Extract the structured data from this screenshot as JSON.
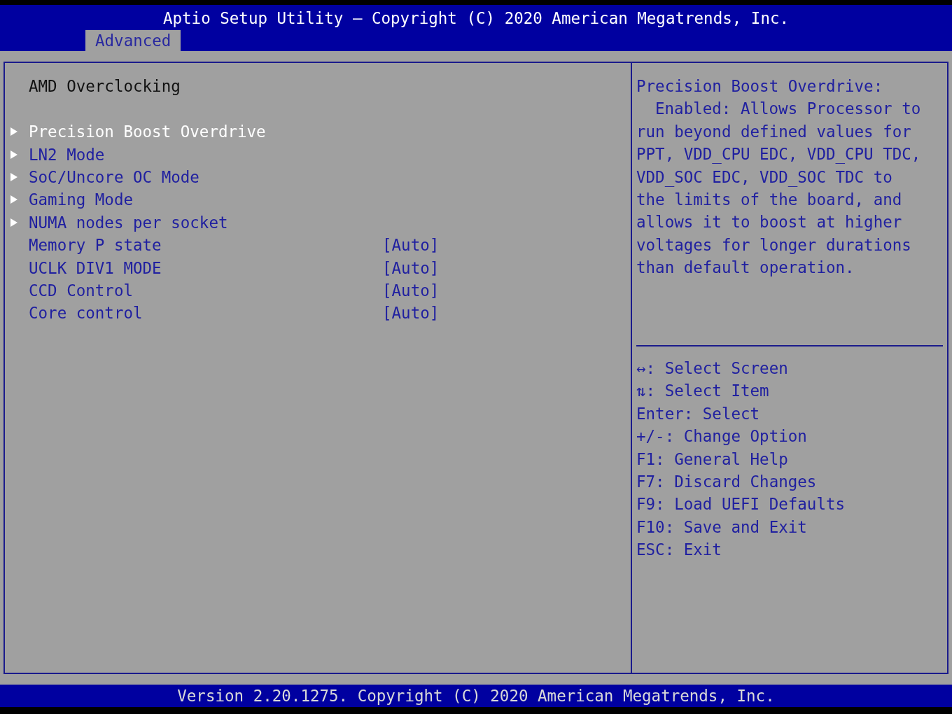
{
  "header": {
    "title": "Aptio Setup Utility – Copyright (C) 2020 American Megatrends, Inc."
  },
  "tabs": [
    {
      "label": "Advanced",
      "selected": true
    }
  ],
  "page": {
    "title": "AMD Overclocking"
  },
  "items": [
    {
      "kind": "submenu",
      "label": "Precision Boost Overdrive",
      "selected": true
    },
    {
      "kind": "submenu",
      "label": "LN2 Mode",
      "selected": false
    },
    {
      "kind": "submenu",
      "label": "SoC/Uncore OC Mode",
      "selected": false
    },
    {
      "kind": "submenu",
      "label": "Gaming Mode",
      "selected": false
    },
    {
      "kind": "submenu",
      "label": "NUMA nodes per socket",
      "selected": false
    },
    {
      "kind": "setting",
      "label": "Memory P state",
      "value": "[Auto]",
      "selected": false
    },
    {
      "kind": "setting",
      "label": "UCLK DIV1 MODE",
      "value": "[Auto]",
      "selected": false
    },
    {
      "kind": "setting",
      "label": "CCD Control",
      "value": "[Auto]",
      "selected": false
    },
    {
      "kind": "setting",
      "label": "Core control",
      "value": "[Auto]",
      "selected": false
    }
  ],
  "help": {
    "lines": [
      {
        "text": "Precision Boost Overdrive:",
        "indent": false
      },
      {
        "text": "Enabled: Allows Processor to",
        "indent": true
      },
      {
        "text": "run beyond defined values for",
        "indent": false
      },
      {
        "text": "PPT, VDD_CPU EDC, VDD_CPU TDC,",
        "indent": false
      },
      {
        "text": "VDD_SOC EDC, VDD_SOC TDC to",
        "indent": false
      },
      {
        "text": "the limits of the board, and",
        "indent": false
      },
      {
        "text": "allows it to boost at higher",
        "indent": false
      },
      {
        "text": "voltages for longer durations",
        "indent": false
      },
      {
        "text": "than default operation.",
        "indent": false
      }
    ]
  },
  "keys": [
    "↔: Select Screen",
    "⇅: Select Item",
    "Enter: Select",
    "+/-: Change Option",
    "F1: General Help",
    "F7: Discard Changes",
    "F9: Load UEFI Defaults",
    "F10: Save and Exit",
    "ESC: Exit"
  ],
  "footer": {
    "text": "Version 2.20.1275. Copyright (C) 2020 American Megatrends, Inc."
  }
}
